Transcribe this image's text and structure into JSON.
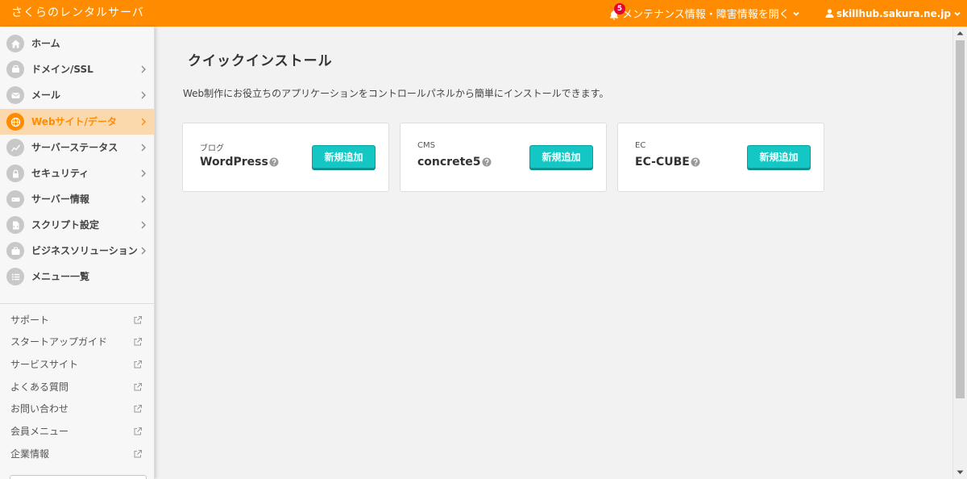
{
  "header": {
    "brand": "さくらのレンタルサーバ",
    "notification_count": "5",
    "maintenance_label": "メンテナンス情報・障害情報を開く",
    "user_label": "skillhub.sakura.ne.jp",
    "accent_color": "#ff8c00"
  },
  "sidebar": {
    "nav": [
      {
        "label": "ホーム",
        "icon": "home-icon"
      },
      {
        "label": "ドメイン/SSL",
        "icon": "domain-icon"
      },
      {
        "label": "メール",
        "icon": "mail-icon"
      },
      {
        "label": "Webサイト/データ",
        "icon": "globe-icon"
      },
      {
        "label": "サーバーステータス",
        "icon": "chart-icon"
      },
      {
        "label": "セキュリティ",
        "icon": "lock-icon"
      },
      {
        "label": "サーバー情報",
        "icon": "server-icon"
      },
      {
        "label": "スクリプト設定",
        "icon": "script-icon"
      },
      {
        "label": "ビジネスソリューション",
        "icon": "briefcase-icon"
      },
      {
        "label": "メニュー一覧",
        "icon": "list-icon"
      }
    ],
    "links": [
      {
        "label": "サポート"
      },
      {
        "label": "スタートアップガイド"
      },
      {
        "label": "サービスサイト"
      },
      {
        "label": "よくある質問"
      },
      {
        "label": "お問い合わせ"
      },
      {
        "label": "会員メニュー"
      },
      {
        "label": "企業情報"
      }
    ]
  },
  "main": {
    "title": "クイックインストール",
    "description": "Web制作にお役立ちのアプリケーションをコントロールパネルから簡単にインストールできます。",
    "cards": [
      {
        "category": "ブログ",
        "name": "WordPress",
        "button": "新規追加"
      },
      {
        "category": "CMS",
        "name": "concrete5",
        "button": "新規追加"
      },
      {
        "category": "EC",
        "name": "EC-CUBE",
        "button": "新規追加"
      }
    ],
    "button_color": "#15c7c4"
  }
}
